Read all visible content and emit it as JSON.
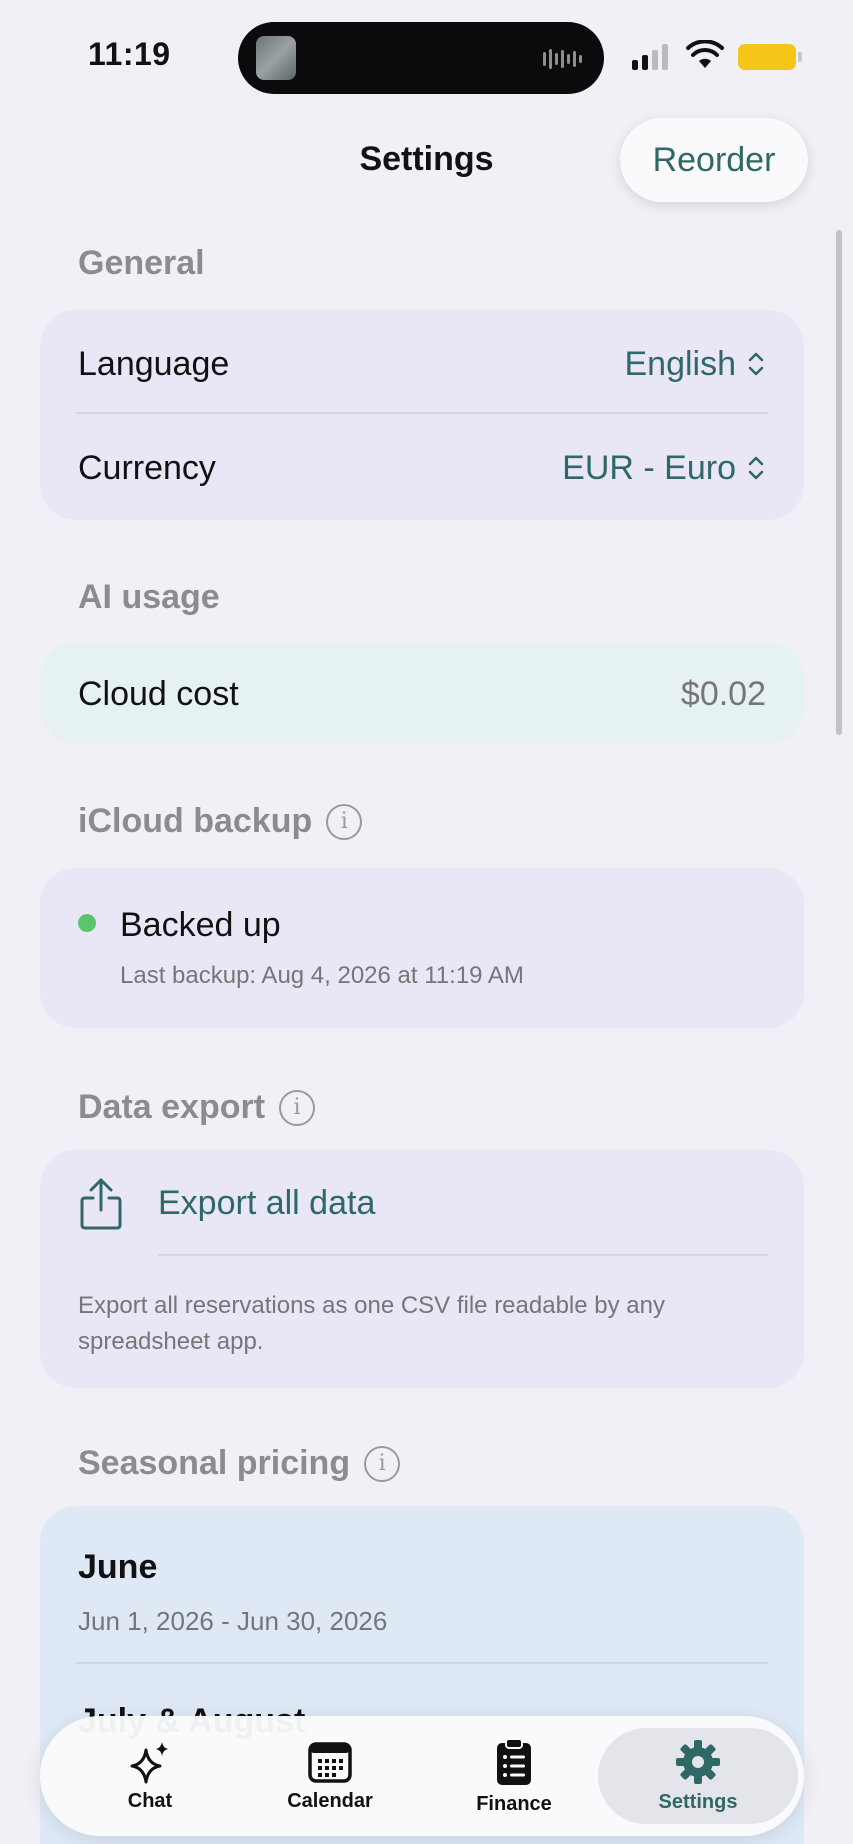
{
  "status_bar": {
    "time": "11:19"
  },
  "header": {
    "title": "Settings",
    "reorder_label": "Reorder"
  },
  "general": {
    "header": "General",
    "language": {
      "label": "Language",
      "value": "English"
    },
    "currency": {
      "label": "Currency",
      "value": "EUR - Euro"
    }
  },
  "ai_usage": {
    "header": "AI usage",
    "cloud_cost": {
      "label": "Cloud cost",
      "value": "$0.02"
    }
  },
  "icloud_backup": {
    "header": "iCloud backup",
    "status": "Backed up",
    "last_backup": "Last backup: Aug 4, 2026 at 11:19 AM",
    "status_color": "#5cc46a"
  },
  "data_export": {
    "header": "Data export",
    "action_label": "Export all data",
    "description_line1": "Export all reservations as one CSV file readable by any",
    "description_line2": "spreadsheet app."
  },
  "seasonal_pricing": {
    "header": "Seasonal pricing",
    "items": [
      {
        "name": "June",
        "range": "Jun 1, 2026 - Jun 30, 2026"
      },
      {
        "name": "July & August",
        "range": ""
      }
    ]
  },
  "tabbar": {
    "tabs": [
      {
        "label": "Chat",
        "icon": "sparkles-icon"
      },
      {
        "label": "Calendar",
        "icon": "calendar-icon"
      },
      {
        "label": "Finance",
        "icon": "clipboard-list-icon"
      },
      {
        "label": "Settings",
        "icon": "gear-icon"
      }
    ],
    "active": "Settings"
  },
  "colors": {
    "accent": "#2f6865",
    "background": "#f1f0f6",
    "card_purple": "#e9e6f6",
    "card_mint": "#e6f1f3",
    "card_blue": "#dfe9f6"
  }
}
